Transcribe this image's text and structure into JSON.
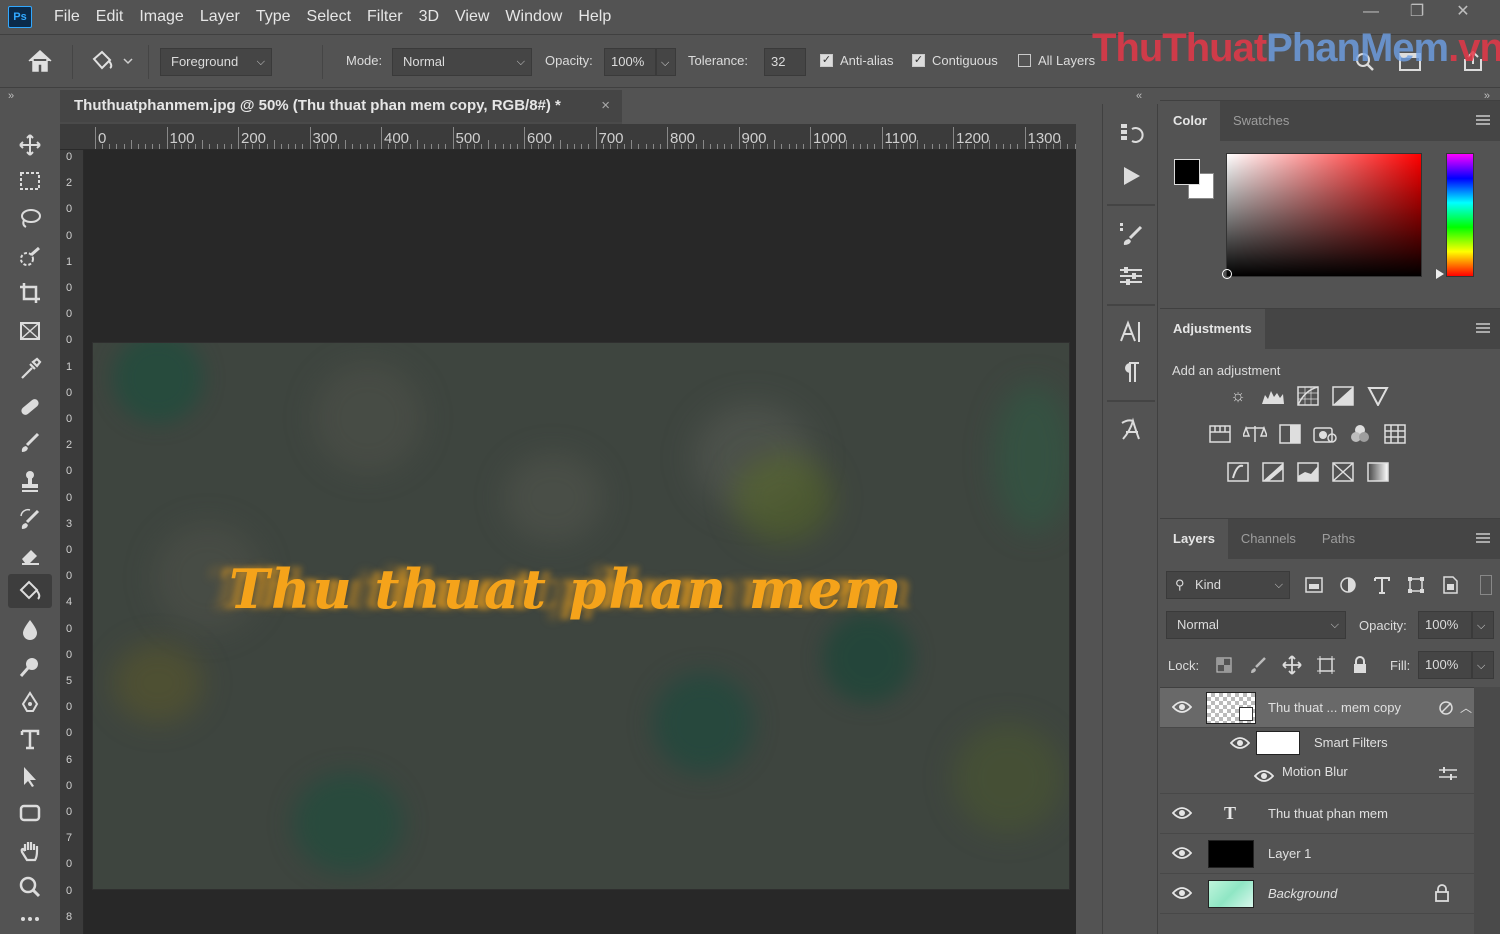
{
  "app": {
    "logo": "Ps"
  },
  "menubar": {
    "items": [
      "File",
      "Edit",
      "Image",
      "Layer",
      "Type",
      "Select",
      "Filter",
      "3D",
      "View",
      "Window",
      "Help"
    ]
  },
  "window_controls": {
    "minimize": "—",
    "restore": "❐",
    "close": "✕"
  },
  "options_bar": {
    "fill_source": "Foreground",
    "mode_label": "Mode:",
    "mode_value": "Normal",
    "opacity_label": "Opacity:",
    "opacity_value": "100%",
    "tolerance_label": "Tolerance:",
    "tolerance_value": "32",
    "anti_alias_label": "Anti-alias",
    "anti_alias_checked": true,
    "contiguous_label": "Contiguous",
    "contiguous_checked": true,
    "all_layers_label": "All Layers",
    "all_layers_checked": false
  },
  "watermark": {
    "part1": "ThuThuat",
    "part2": "PhanMem",
    "part3": ".vn"
  },
  "collapse_glyph": "»",
  "collapse_glyph_left": "«",
  "document_tab": {
    "title": "Thuthuatphanmem.jpg @ 50% (Thu thuat phan mem copy, RGB/8#) *",
    "close": "×"
  },
  "rulers": {
    "horizontal": [
      "0",
      "100",
      "200",
      "300",
      "400",
      "500",
      "600",
      "700",
      "800",
      "900",
      "1000",
      "1100",
      "1200",
      "1300"
    ],
    "vertical": [
      "0",
      "2",
      "0",
      "0",
      "1",
      "0",
      "0",
      "0",
      "1",
      "0",
      "0",
      "2",
      "0",
      "0",
      "3",
      "0",
      "0",
      "4",
      "0",
      "0",
      "5",
      "0",
      "0",
      "6",
      "0",
      "0",
      "7",
      "0",
      "0",
      "8"
    ]
  },
  "canvas": {
    "art_text": "Thu thuat phan mem",
    "art_color": "#f5a31a"
  },
  "color_panel": {
    "tabs": [
      "Color",
      "Swatches"
    ],
    "foreground": "#000000",
    "background": "#ffffff"
  },
  "adjustments_panel": {
    "tabs": [
      "Adjustments"
    ],
    "subtitle": "Add an adjustment"
  },
  "layers_panel": {
    "tabs": [
      "Layers",
      "Channels",
      "Paths"
    ],
    "filter_kind": "Kind",
    "blend_mode": "Normal",
    "opacity_label": "Opacity:",
    "opacity_value": "100%",
    "lock_label": "Lock:",
    "fill_label": "Fill:",
    "fill_value": "100%",
    "layers": [
      {
        "name": "Thu thuat ... mem copy"
      },
      {
        "name": "Smart Filters"
      },
      {
        "name": "Motion Blur"
      },
      {
        "name": "Thu thuat phan mem"
      },
      {
        "name": "Layer 1"
      },
      {
        "name": "Background"
      }
    ],
    "text_layer_glyph": "T"
  }
}
